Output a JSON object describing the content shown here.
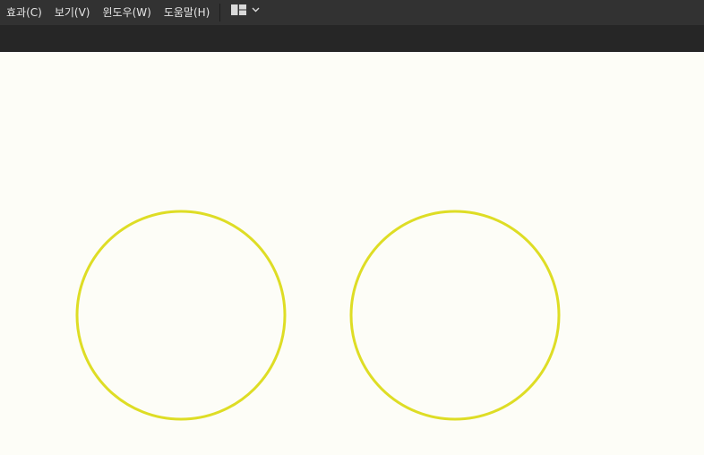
{
  "menubar": {
    "items": [
      {
        "label": "효과(C)",
        "name": "menu-effects"
      },
      {
        "label": "보기(V)",
        "name": "menu-view"
      },
      {
        "label": "윈도우(W)",
        "name": "menu-window"
      },
      {
        "label": "도움말(H)",
        "name": "menu-help"
      }
    ],
    "workspace_icon": "workspace-layout-icon",
    "dropdown_icon": "chevron-down-icon"
  },
  "colors": {
    "menubar_bg": "#323232",
    "toolbar_bg": "#262626",
    "canvas_bg": "#fdfdf7",
    "circle_stroke": "#dedd25"
  },
  "canvas": {
    "shapes": [
      {
        "type": "circle",
        "name": "circle-left",
        "stroke": "#dedd25",
        "fill": "none"
      },
      {
        "type": "circle",
        "name": "circle-right",
        "stroke": "#dedd25",
        "fill": "none"
      }
    ]
  }
}
